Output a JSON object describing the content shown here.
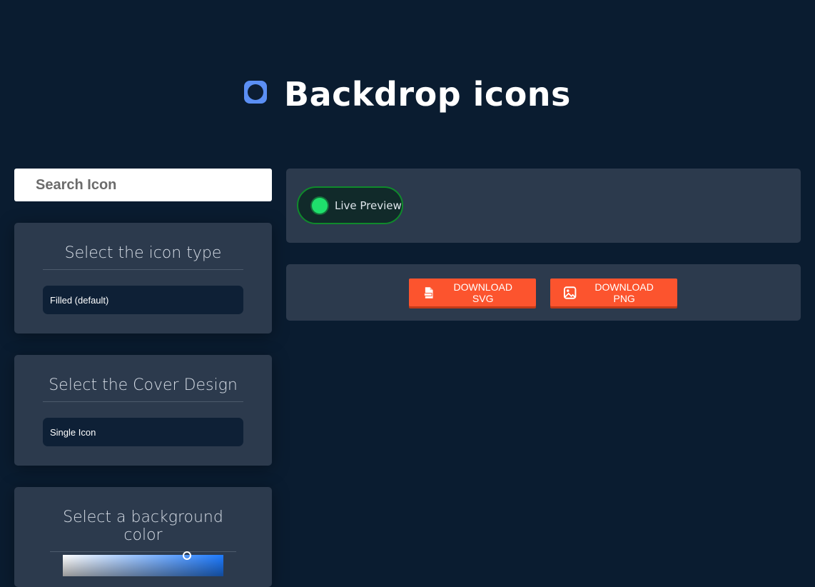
{
  "header": {
    "title": "Backdrop icons",
    "logo_icon": "rounded-square-circle-icon",
    "logo_color": "#5b8ff4"
  },
  "search": {
    "placeholder": "Search Icon",
    "value": ""
  },
  "icon_type_panel": {
    "title": "Select the icon type",
    "selected": "Filled (default)"
  },
  "cover_design_panel": {
    "title": "Select the Cover Design",
    "selected": "Single Icon"
  },
  "background_color_panel": {
    "title": "Select a background color",
    "picker_color": "#1e7bff"
  },
  "preview": {
    "live_label": "Live Preview",
    "live_active": true,
    "live_color": "#1fe06c"
  },
  "downloads": {
    "svg_label": "DOWNLOAD SVG",
    "svg_icon": "file-svg-icon",
    "png_label": "DOWNLOAD PNG",
    "png_icon": "image-icon",
    "accent_color": "#fc542e"
  },
  "colors": {
    "background": "#0a1c30",
    "panel": "#2c3a4d"
  }
}
